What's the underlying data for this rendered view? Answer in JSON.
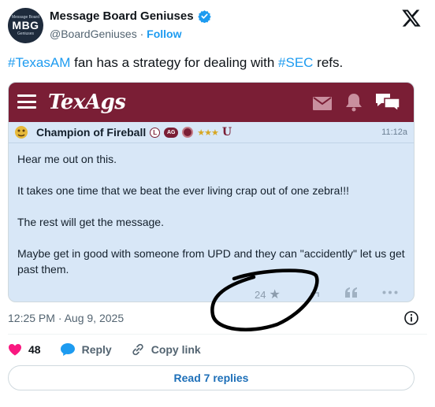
{
  "account": {
    "avatar_top": "Message Board",
    "avatar_mid": "MBG",
    "avatar_bot": "Geniuses",
    "display_name": "Message Board Geniuses",
    "handle": "@BoardGeniuses",
    "separator": "·",
    "follow_label": "Follow"
  },
  "tweet": {
    "hashtag1": "#TexasAM",
    "text_mid": " fan has a strategy for dealing with ",
    "hashtag2": "#SEC",
    "text_end": " refs.",
    "timestamp": "12:25 PM · Aug 9, 2025"
  },
  "texags": {
    "logo_text": "TexAgs",
    "poster_name": "Champion of Fireball",
    "badge_l": "L",
    "badge_ag": "AG",
    "stars": "★★★",
    "badge_u": "U",
    "post_time": "11:12a",
    "body": [
      "Hear me out on this.",
      "It takes one time that we beat the ever living crap out of one zebra!!!",
      "The rest will get the message.",
      "Maybe get in good with someone from UPD and they can \"accidently\" let us get past them."
    ],
    "star_count": "24",
    "header_color": "#7a1e35",
    "body_bg": "#d8e7f7"
  },
  "engagement": {
    "likes": "48",
    "reply_label": "Reply",
    "copy_link_label": "Copy link"
  },
  "read_replies_label": "Read 7 replies",
  "colors": {
    "accent": "#1d9bf0",
    "like": "#f91880"
  }
}
